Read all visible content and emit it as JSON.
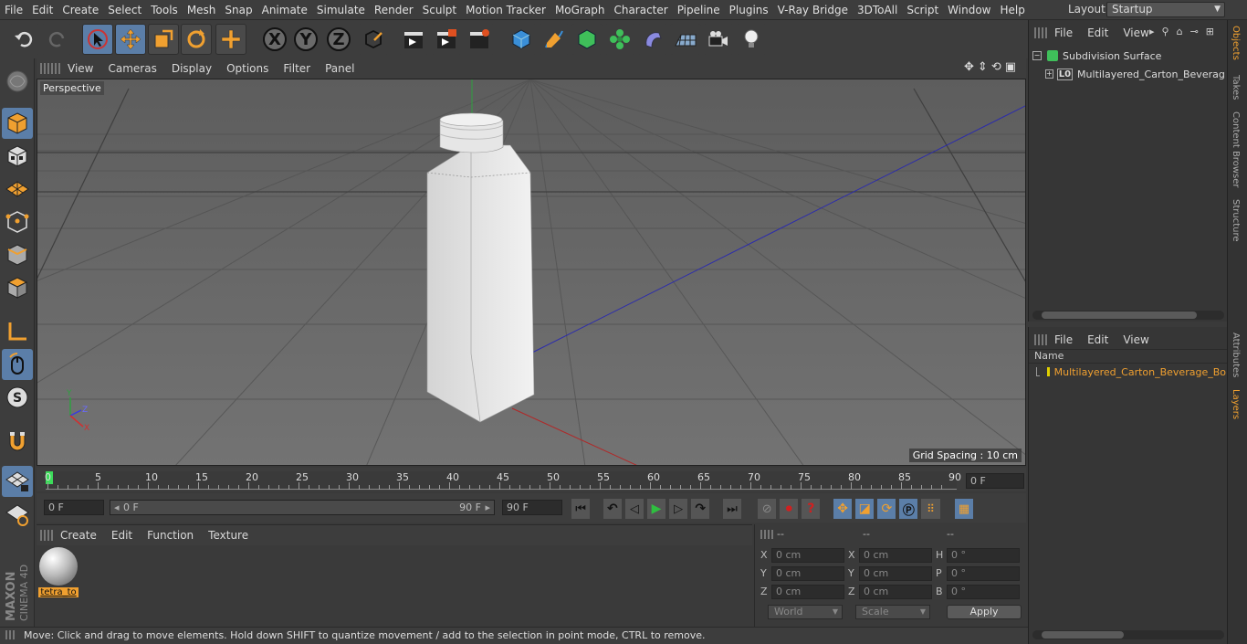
{
  "menubar": [
    "File",
    "Edit",
    "Create",
    "Select",
    "Tools",
    "Mesh",
    "Snap",
    "Animate",
    "Simulate",
    "Render",
    "Sculpt",
    "Motion Tracker",
    "MoGraph",
    "Character",
    "Pipeline",
    "Plugins",
    "V-Ray Bridge",
    "3DToAll",
    "Script",
    "Window",
    "Help"
  ],
  "layout": {
    "label": "Layout:",
    "value": "Startup"
  },
  "viewport": {
    "menu": [
      "View",
      "Cameras",
      "Display",
      "Options",
      "Filter",
      "Panel"
    ],
    "camera": "Perspective",
    "grid_spacing": "Grid Spacing : 10 cm"
  },
  "timeline": {
    "ticks": [
      "0",
      "5",
      "10",
      "15",
      "20",
      "25",
      "30",
      "35",
      "40",
      "45",
      "50",
      "55",
      "60",
      "65",
      "70",
      "75",
      "80",
      "85",
      "90"
    ],
    "current_frame": "0 F",
    "start_field": "0 F",
    "range_start": "0 F",
    "range_end": "90 F",
    "end_field": "90 F"
  },
  "materials": {
    "menu": [
      "Create",
      "Edit",
      "Function",
      "Texture"
    ],
    "items": [
      {
        "name": "tetra_to"
      }
    ]
  },
  "coords": {
    "headers": [
      "--",
      "--",
      "--"
    ],
    "rows": [
      {
        "a": "X",
        "av": "0 cm",
        "b": "X",
        "bv": "0 cm",
        "c": "H",
        "cv": "0 °"
      },
      {
        "a": "Y",
        "av": "0 cm",
        "b": "Y",
        "bv": "0 cm",
        "c": "P",
        "cv": "0 °"
      },
      {
        "a": "Z",
        "av": "0 cm",
        "b": "Z",
        "bv": "0 cm",
        "c": "B",
        "cv": "0 °"
      }
    ],
    "mode": "World",
    "scale": "Scale",
    "apply": "Apply"
  },
  "objects": {
    "menu": [
      "File",
      "Edit",
      "View"
    ],
    "items": [
      {
        "name": "Subdivision Surface"
      },
      {
        "name": "Multilayered_Carton_Beverage_B"
      }
    ]
  },
  "layers": {
    "menu": [
      "File",
      "Edit",
      "View"
    ],
    "column": "Name",
    "items": [
      {
        "name": "Multilayered_Carton_Beverage_Bo"
      }
    ]
  },
  "sidetabs": {
    "top": [
      "Objects",
      "Takes",
      "Content Browser",
      "Structure"
    ],
    "bottom": [
      "Attributes",
      "Layers"
    ]
  },
  "status": "Move: Click and drag to move elements. Hold down SHIFT to quantize movement / add to the selection in point mode, CTRL to remove.",
  "brand": {
    "line1": "MAXON",
    "line2": "CINEMA 4D"
  },
  "colors": {
    "accent": "#5b7ea8",
    "selection": "#f0a030",
    "layer_swatch": "#e0d000"
  }
}
